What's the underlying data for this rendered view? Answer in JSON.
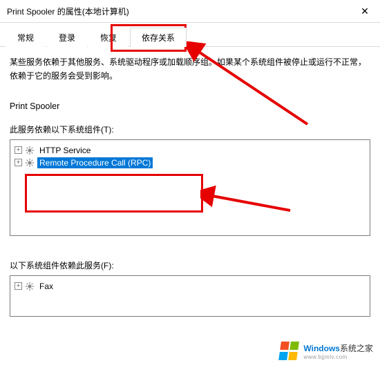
{
  "window": {
    "title": "Print Spooler 的属性(本地计算机)",
    "close": "✕"
  },
  "tabs": {
    "general": "常规",
    "logon": "登录",
    "recovery": "恢复",
    "deps": "依存关系"
  },
  "desc": "某些服务依赖于其他服务、系统驱动程序或加载顺序组。如果某个系统组件被停止或运行不正常，依赖于它的服务会受到影响。",
  "service_name": "Print Spooler",
  "labels": {
    "depends_on": "此服务依赖以下系统组件(T):",
    "depended_by": "以下系统组件依赖此服务(F):"
  },
  "depends_tree": {
    "items": [
      {
        "label": "HTTP Service",
        "expandable": true
      },
      {
        "label": "Remote Procedure Call (RPC)",
        "expandable": true,
        "selected": true
      }
    ]
  },
  "depended_tree": {
    "items": [
      {
        "label": "Fax",
        "expandable": true
      }
    ]
  },
  "watermark": {
    "brand_en": "Windows",
    "brand_cn": "系统之家",
    "url": "www.bjjmlv.com"
  }
}
